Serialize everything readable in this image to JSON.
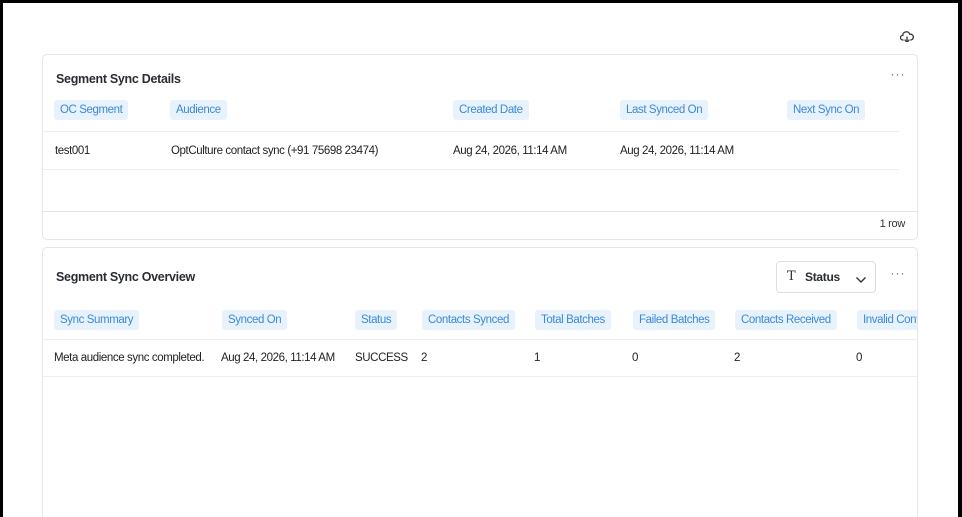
{
  "segment_sync_details": {
    "title": "Segment Sync Details",
    "more": "···",
    "columns": [
      "OC Segment",
      "Audience",
      "Created Date",
      "Last Synced On",
      "Next Sync On"
    ],
    "rows": [
      [
        "test001",
        "OptCulture contact sync (+91 75698 23474)",
        "Aug 24, 2026, 11:14 AM",
        "Aug 24, 2026, 11:14 AM",
        ""
      ]
    ],
    "row_count": "1 row"
  },
  "segment_sync_overview": {
    "title": "Segment Sync Overview",
    "more": "···",
    "filter": {
      "icon": "T",
      "label": "Status"
    },
    "columns": [
      "Sync Summary",
      "Synced On",
      "Status",
      "Contacts Synced",
      "Total Batches",
      "Failed Batches",
      "Contacts Received",
      "Invalid Cont"
    ],
    "rows": [
      [
        "Meta audience sync completed.",
        "Aug 24, 2026, 11:14 AM",
        "SUCCESS",
        "2",
        "1",
        "0",
        "2",
        "0"
      ]
    ]
  },
  "icons": {
    "top_right": "cloud-refresh-icon",
    "filter_chevron": "chevron-down-icon"
  }
}
